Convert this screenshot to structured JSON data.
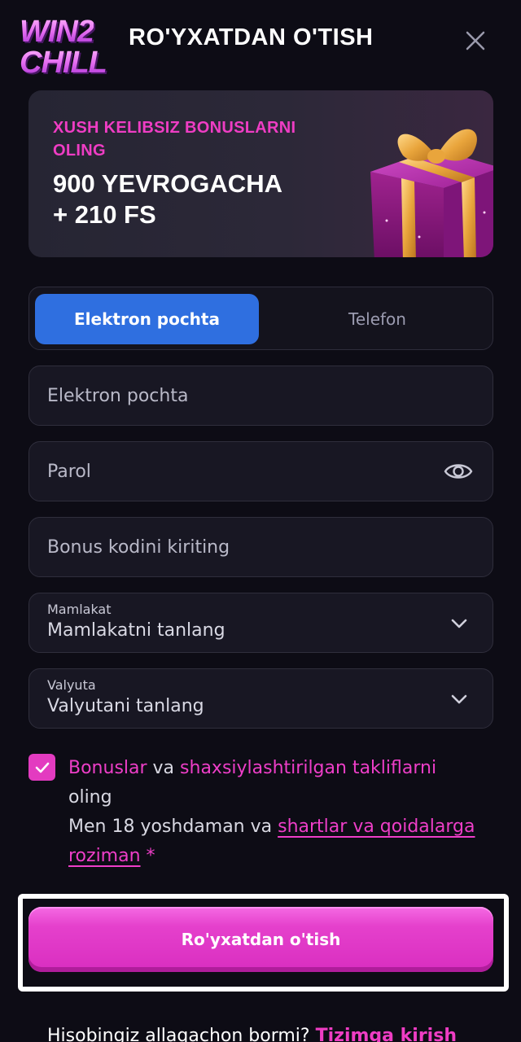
{
  "header": {
    "logo_line1": "WIN2",
    "logo_line2": "CHILL",
    "title": "RO'YXATDAN O'TISH"
  },
  "banner": {
    "promo": "XUSH KELIBSIZ BONUSLARNI OLING",
    "amount_line1": "900 YEVROGACHA",
    "amount_line2": "+ 210 FS"
  },
  "tabs": [
    {
      "label": "Elektron pochta",
      "active": true
    },
    {
      "label": "Telefon",
      "active": false
    }
  ],
  "fields": {
    "email_placeholder": "Elektron pochta",
    "password_placeholder": "Parol",
    "bonus_placeholder": "Bonus kodini kiriting",
    "country_label": "Mamlakat",
    "country_value": "Mamlakatni tanlang",
    "currency_label": "Valyuta",
    "currency_value": "Valyutani tanlang"
  },
  "agreement": {
    "checked": true,
    "bonuses": "Bonuslar",
    "and1": " va ",
    "offers": "shaxsiylashtirilgan takliflarni",
    "get": " oling",
    "age_text": "Men 18 yoshdaman va ",
    "terms_link": "shartlar va qoidalarga roziman",
    "required_mark": " *"
  },
  "submit_label": "Ro'yxatdan o'tish",
  "footer": {
    "question": "Hisobingiz allaqachon bormi? ",
    "login_link": "Tizimga kirish"
  },
  "colors": {
    "accent_pink": "#e33bc0",
    "tab_active": "#2f6fe0",
    "background": "#0d0c15"
  }
}
